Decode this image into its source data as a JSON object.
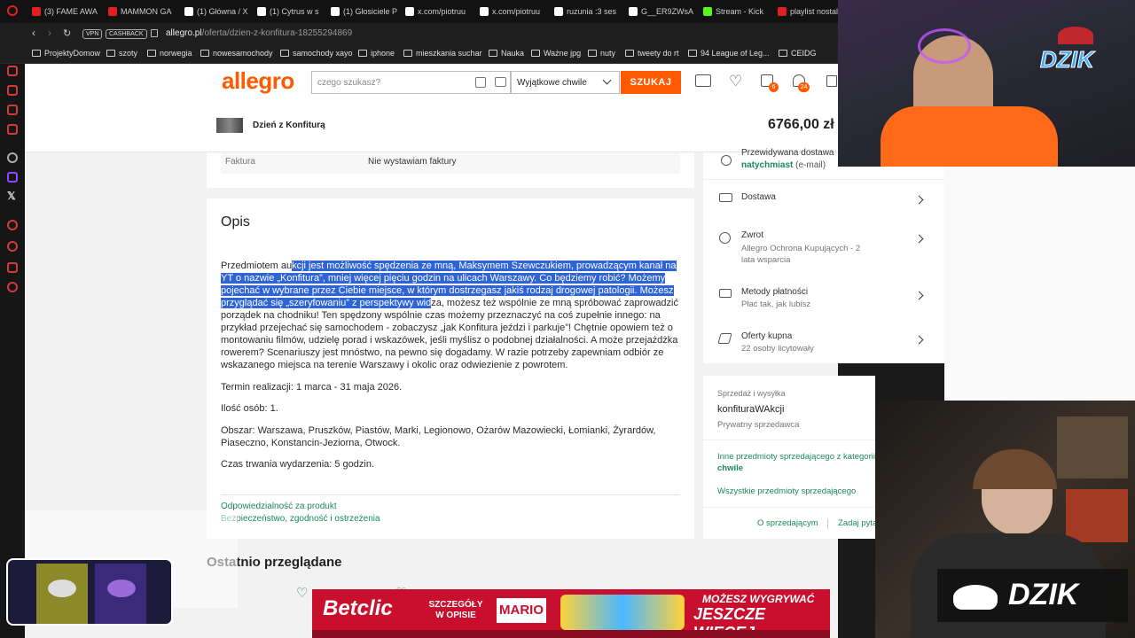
{
  "tabs": [
    {
      "label": "(3) FAME AWA",
      "color": "#e02020"
    },
    {
      "label": "MAMMON GA",
      "color": "#e02020"
    },
    {
      "label": "(1) Główna / X",
      "color": "#ffffff"
    },
    {
      "label": "(1) Cytrus w s",
      "color": "#ffffff"
    },
    {
      "label": "(1) Głosiciele P",
      "color": "#ffffff"
    },
    {
      "label": "x.com/piotruu",
      "color": "#ffffff"
    },
    {
      "label": "x.com/piotruu",
      "color": "#ffffff"
    },
    {
      "label": "ruzunia :3 ses",
      "color": "#ffffff"
    },
    {
      "label": "G__ER9ZWsA",
      "color": "#ffffff"
    },
    {
      "label": "Stream - Kick",
      "color": "#53fc18"
    },
    {
      "label": "playlist nostal",
      "color": "#e02020"
    }
  ],
  "address": {
    "vpn": "VPN",
    "cashback": "CASHBACK",
    "url_host": "allegro.pl",
    "url_path": "/oferta/dzien-z-konfitura-18255294869"
  },
  "bookmarks": [
    "ProjektyDomow",
    "szoty",
    "norwegia",
    "nowesamochody",
    "samochody xayo",
    "iphone",
    "mieszkania suchar",
    "Nauka",
    "Ważne jpg",
    "nuty",
    "tweety do rt",
    "94 League of Leg...",
    "CEIDG"
  ],
  "header": {
    "logo": "allegro",
    "search_placeholder": "czego szukasz?",
    "category": "Wyjątkowe chwile",
    "search_button": "SZUKAJ",
    "notif_badge_1": "6",
    "notif_badge_2": "24"
  },
  "sticky": {
    "product_name": "Dzień z Konfiturą",
    "price": "6766,00 zł"
  },
  "invoice": {
    "label": "Faktura",
    "value": "Nie wystawiam faktury"
  },
  "description": {
    "heading": "Opis",
    "p1_plain_start": "Przedmiotem au",
    "p1_highlight": "kcji jest możliwość spędzenia ze mną, Maksymem Szewczukiem, prowadzącym kanał na YT o nazwie „Konfitura”, mniej więcej pięciu godzin na ulicach Warszawy. Co będziemy robić? Możemy pojechać w wybrane przez Ciebie miejsce, w którym dostrzegasz jakiś rodzaj drogowej patologii. Możesz przyglądać się „szeryfowaniu” z perspektywy wid",
    "p1_plain_end": "za, możesz też wspólnie ze mną spróbować zaprowadzić porządek na chodniku! Ten spędzony wspólnie czas możemy przeznaczyć na coś zupełnie innego: na przykład przejechać się samochodem - zobaczysz „jak Konfitura jeździ i parkuje”! Chętnie opowiem też o montowaniu filmów, udzielę porad i wskazówek, jeśli myślisz o podobnej działalności. A może przejażdżka rowerem? Scenariuszy jest mnóstwo, na pewno się dogadamy. W razie potrzeby zapewniam odbiór ze wskazanego miejsca na terenie Warszawy i okolic oraz odwiezienie z powrotem.",
    "term": "Termin realizacji: 1 marca - 31 maja 2026.",
    "persons": "Ilość osób: 1.",
    "area": "Obszar: Warszawa, Pruszków, Piastów, Marki, Legionowo, Ożarów Mazowiecki, Łomianki, Żyrardów, Piaseczno, Konstancin-Jeziorna, Otwock.",
    "duration": "Czas trwania wydarzenia: 5 godzin.",
    "link_responsibility": "Odpowiedzialność za produkt",
    "link_safety": "Bezpieczeństwo, zgodność i ostrzeżenia",
    "recently_viewed": "Ostatnio przeglądane"
  },
  "side": {
    "delivery_expected": "Przewidywana dostawa",
    "delivery_date": "natychmiast",
    "delivery_method": " (e-mail)",
    "rows": [
      {
        "title": "Dostawa",
        "sub": ""
      },
      {
        "title": "Zwrot",
        "sub": "Allegro Ochrona Kupujących - 2 lata wsparcia"
      },
      {
        "title": "Metody płatności",
        "sub": "Płać tak, jak lubisz"
      },
      {
        "title": "Oferty kupna",
        "sub": "22 osoby licytowały"
      }
    ],
    "seller_header": "Sprzedaż i wysyłka",
    "seller_name": "konfituraWAkcji",
    "seller_type": "Prywatny sprzedawca",
    "other_items": "Inne przedmioty sprzedającego z kategorii",
    "other_items_cat": "chwile",
    "all_items": "Wszystkie przedmioty sprzedającego",
    "about_seller": "O sprzedającym",
    "ask_question": "Zadaj pytanie"
  },
  "overlay": {
    "brand": "DZIK",
    "ad_brand": "Betclic",
    "ad_details": "SZCZEGÓŁY W OPISIE",
    "ad_name": "MARIO",
    "ad_slogan_1": "MOŻESZ WYGRYWAĆ",
    "ad_slogan_2": "JESZCZE WIĘCEJ",
    "colors": {
      "allegro_orange": "#ff5a00",
      "highlight": "#2f64d4",
      "link_green": "#1a8a5a"
    }
  }
}
